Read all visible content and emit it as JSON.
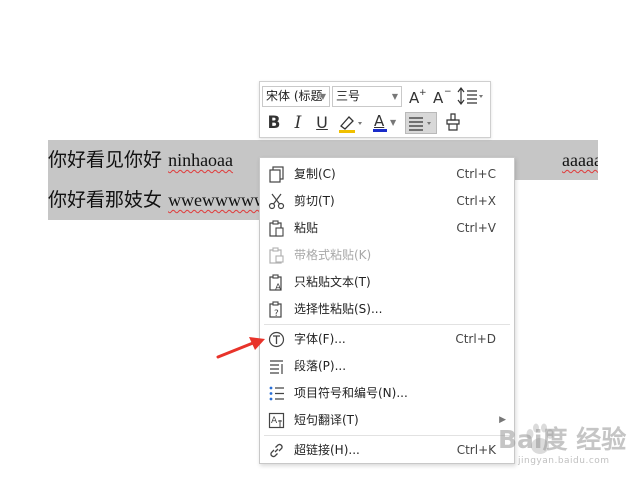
{
  "document": {
    "line1_cn": "你好看见你好",
    "line1_latin": "ninhaoaa",
    "line1_tail": "aaaaaaa",
    "line2_cn": "你好看那妓女",
    "line2_latin": "wwewwwww"
  },
  "mini_toolbar": {
    "font_name": "宋体 (标题",
    "font_size": "三号",
    "bold_label": "B",
    "italic_label": "I",
    "underline_label": "U",
    "font_color_label": "A",
    "font_color": "#1a2cc9",
    "highlight_color": "#f0c000"
  },
  "context_menu": {
    "items": [
      {
        "label": "复制(C)",
        "shortcut": "Ctrl+C",
        "icon": "copy-icon"
      },
      {
        "label": "剪切(T)",
        "shortcut": "Ctrl+X",
        "icon": "scissors-icon"
      },
      {
        "label": "粘贴",
        "shortcut": "Ctrl+V",
        "icon": "paste-icon"
      },
      {
        "label": "带格式粘贴(K)",
        "shortcut": "",
        "icon": "paste-format-icon",
        "disabled": true
      },
      {
        "label": "只粘贴文本(T)",
        "shortcut": "",
        "icon": "paste-text-icon"
      },
      {
        "label": "选择性粘贴(S)...",
        "shortcut": "",
        "icon": "paste-special-icon"
      },
      {
        "label": "字体(F)...",
        "shortcut": "Ctrl+D",
        "icon": "font-icon"
      },
      {
        "label": "段落(P)...",
        "shortcut": "",
        "icon": "paragraph-icon"
      },
      {
        "label": "项目符号和编号(N)...",
        "shortcut": "",
        "icon": "bullets-icon"
      },
      {
        "label": "短句翻译(T)",
        "shortcut": "",
        "icon": "translate-icon",
        "submenu": true
      },
      {
        "label": "超链接(H)...",
        "shortcut": "Ctrl+K",
        "icon": "link-icon"
      }
    ]
  },
  "watermark": {
    "brand": "Bai度 经验",
    "url": "jingyan.baidu.com"
  }
}
